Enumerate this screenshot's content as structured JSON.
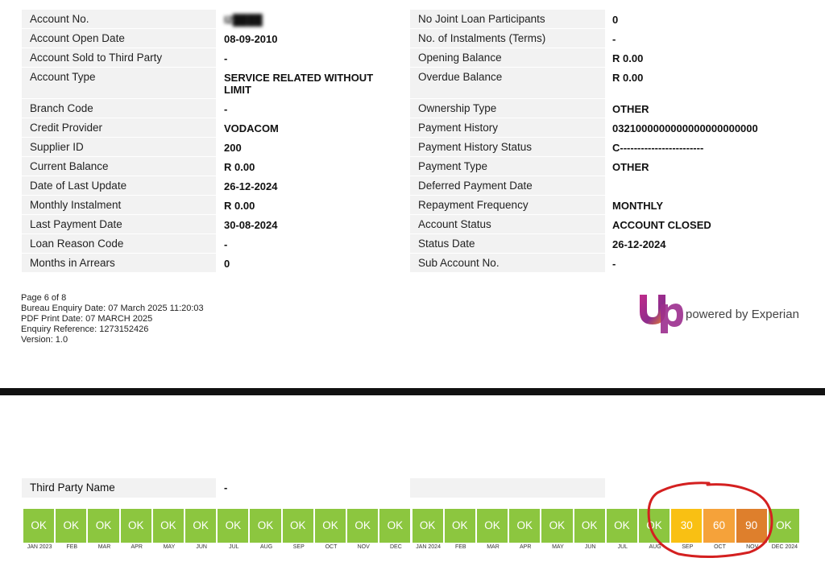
{
  "left_rows": [
    {
      "label": "Account No.",
      "value": "I2████",
      "blur": true
    },
    {
      "label": "Account Open Date",
      "value": "08-09-2010"
    },
    {
      "label": "Account Sold to Third Party",
      "value": "-"
    },
    {
      "label": "Account Type",
      "value": "SERVICE RELATED WITHOUT LIMIT",
      "tall": true
    },
    {
      "label": "Branch Code",
      "value": "-"
    },
    {
      "label": "Credit Provider",
      "value": "VODACOM"
    },
    {
      "label": "Supplier ID",
      "value": "200"
    },
    {
      "label": "Current Balance",
      "value": "R 0.00"
    },
    {
      "label": "Date of Last Update",
      "value": "26-12-2024"
    },
    {
      "label": "Monthly Instalment",
      "value": "R 0.00"
    },
    {
      "label": "Last Payment Date",
      "value": "30-08-2024"
    },
    {
      "label": "Loan Reason Code",
      "value": "-"
    },
    {
      "label": "Months in Arrears",
      "value": "0"
    }
  ],
  "right_rows": [
    {
      "label": "No Joint Loan Participants",
      "value": "0"
    },
    {
      "label": "No. of Instalments (Terms)",
      "value": "-"
    },
    {
      "label": "Opening Balance",
      "value": "R 0.00"
    },
    {
      "label": "Overdue Balance",
      "value": "R 0.00",
      "tall": true
    },
    {
      "label": "Ownership Type",
      "value": "OTHER"
    },
    {
      "label": "Payment History",
      "value": "0321000000000000000000000"
    },
    {
      "label": "Payment History Status",
      "value": "C------------------------"
    },
    {
      "label": "Payment Type",
      "value": "OTHER"
    },
    {
      "label": "Deferred Payment Date",
      "value": ""
    },
    {
      "label": "Repayment Frequency",
      "value": "MONTHLY"
    },
    {
      "label": "Account Status",
      "value": "ACCOUNT CLOSED"
    },
    {
      "label": "Status Date",
      "value": "26-12-2024"
    },
    {
      "label": "Sub Account No.",
      "value": "-"
    }
  ],
  "footer": {
    "page": "Page 6 of 8",
    "bureau_enquiry_date": "Bureau Enquiry Date: 07 March 2025 11:20:03",
    "pdf_print_date": "PDF Print Date: 07 MARCH 2025",
    "enquiry_reference": "Enquiry Reference: 1273152426",
    "version": "Version: 1.0"
  },
  "logo": {
    "text": "powered by Experian"
  },
  "third_party": {
    "label": "Third Party Name",
    "value": "-"
  },
  "history": [
    {
      "month": "JAN 2023",
      "status": "OK",
      "color": "#8cc63f"
    },
    {
      "month": "FEB",
      "status": "OK",
      "color": "#8cc63f"
    },
    {
      "month": "MAR",
      "status": "OK",
      "color": "#8cc63f"
    },
    {
      "month": "APR",
      "status": "OK",
      "color": "#8cc63f"
    },
    {
      "month": "MAY",
      "status": "OK",
      "color": "#8cc63f"
    },
    {
      "month": "JUN",
      "status": "OK",
      "color": "#8cc63f"
    },
    {
      "month": "JUL",
      "status": "OK",
      "color": "#8cc63f"
    },
    {
      "month": "AUG",
      "status": "OK",
      "color": "#8cc63f"
    },
    {
      "month": "SEP",
      "status": "OK",
      "color": "#8cc63f"
    },
    {
      "month": "OCT",
      "status": "OK",
      "color": "#8cc63f"
    },
    {
      "month": "NOV",
      "status": "OK",
      "color": "#8cc63f"
    },
    {
      "month": "DEC",
      "status": "OK",
      "color": "#8cc63f"
    },
    {
      "month": "JAN 2024",
      "status": "OK",
      "color": "#8cc63f"
    },
    {
      "month": "FEB",
      "status": "OK",
      "color": "#8cc63f"
    },
    {
      "month": "MAR",
      "status": "OK",
      "color": "#8cc63f"
    },
    {
      "month": "APR",
      "status": "OK",
      "color": "#8cc63f"
    },
    {
      "month": "MAY",
      "status": "OK",
      "color": "#8cc63f"
    },
    {
      "month": "JUN",
      "status": "OK",
      "color": "#8cc63f"
    },
    {
      "month": "JUL",
      "status": "OK",
      "color": "#8cc63f"
    },
    {
      "month": "AUG",
      "status": "OK",
      "color": "#8cc63f"
    },
    {
      "month": "SEP",
      "status": "30",
      "color": "#f9c013"
    },
    {
      "month": "OCT",
      "status": "60",
      "color": "#f5a23a"
    },
    {
      "month": "NOV",
      "status": "90",
      "color": "#de7f2c"
    },
    {
      "month": "DEC 2024",
      "status": "OK",
      "color": "#8cc63f"
    }
  ],
  "colors": {
    "ok": "#8cc63f",
    "annotation": "#d42020",
    "logo_magenta": "#9b2d8e",
    "logo_orange": "#f08a24"
  }
}
